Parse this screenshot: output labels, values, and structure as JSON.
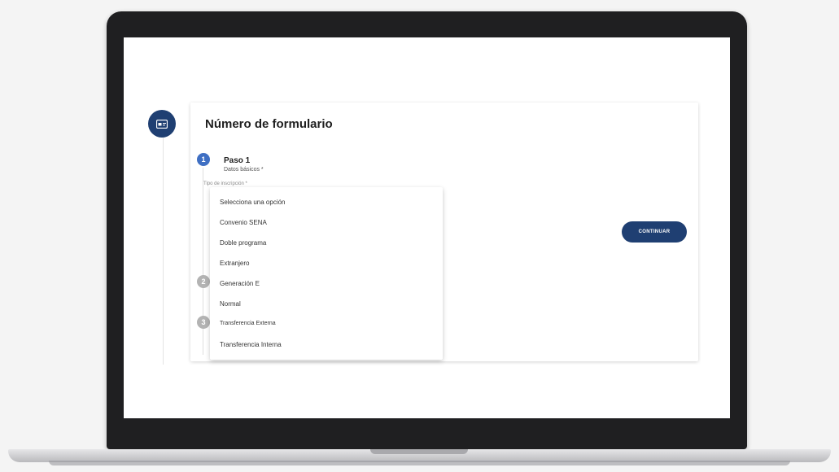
{
  "form": {
    "title": "Número de formulario",
    "icon": "form-card-icon",
    "steps": [
      {
        "number": "1",
        "title": "Paso 1",
        "subtitle": "Datos básicos *",
        "state": "active"
      },
      {
        "number": "2",
        "state": "inactive"
      },
      {
        "number": "3",
        "state": "inactive"
      }
    ],
    "field_label": "Tipo de inscripción *",
    "options": [
      "Selecciona una opción",
      "Convenio SENA",
      "Doble programa",
      "Extranjero",
      "Generación E",
      "Normal",
      "Transferencia Externa",
      "Transferencia Interna"
    ],
    "continue_label": "CONTINUAR"
  },
  "colors": {
    "primary": "#1f3f72",
    "step_active": "#3f6fc3",
    "step_inactive": "#b3b3b3"
  }
}
